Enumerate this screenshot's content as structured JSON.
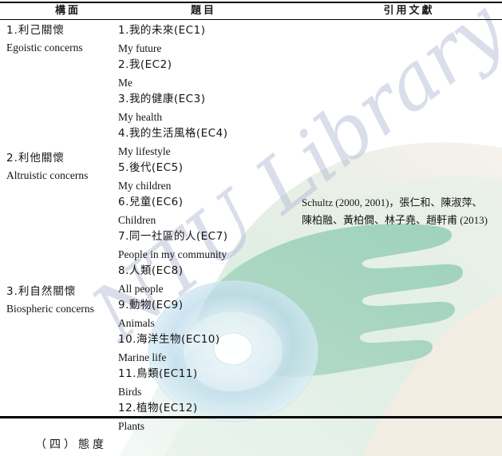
{
  "document": {
    "watermark_text": "NTU Library",
    "section_heading": "（四）態度"
  },
  "table": {
    "headers": {
      "dimension": "構面",
      "item": "題目",
      "references": "引用文獻"
    },
    "groups": [
      {
        "dimension_zh": "1.利己關懷",
        "dimension_en": "Egoistic concerns",
        "items": [
          {
            "zh": "1.我的未來(EC1)",
            "en": "My future"
          },
          {
            "zh": "2.我(EC2)",
            "en": "Me"
          },
          {
            "zh": "3.我的健康(EC3)",
            "en": "My health"
          },
          {
            "zh": "4.我的生活風格(EC4)",
            "en": "My lifestyle"
          }
        ]
      },
      {
        "dimension_zh": "2.利他關懷",
        "dimension_en": "Altruistic concerns",
        "items": [
          {
            "zh": "5.後代(EC5)",
            "en": "My children"
          },
          {
            "zh": "6.兒童(EC6)",
            "en": "Children"
          },
          {
            "zh": "7.同一社區的人(EC7)",
            "en": "People in my community"
          },
          {
            "zh": "8.人類(EC8)",
            "en": "All people"
          }
        ]
      },
      {
        "dimension_zh": "3.利自然關懷",
        "dimension_en": "Biospheric concerns",
        "items": [
          {
            "zh": "9.動物(EC9)",
            "en": "Animals"
          },
          {
            "zh": "10.海洋生物(EC10)",
            "en": "Marine life"
          },
          {
            "zh": "11.鳥類(EC11)",
            "en": "Birds"
          },
          {
            "zh": "12.植物(EC12)",
            "en": "Plants"
          }
        ]
      }
    ],
    "references": {
      "line1": "Schultz (2000, 2001)，張仁和、陳淑萍、",
      "line2": "陳柏融、黃柏僩、林子堯、趙軒甫 (2013)"
    }
  }
}
